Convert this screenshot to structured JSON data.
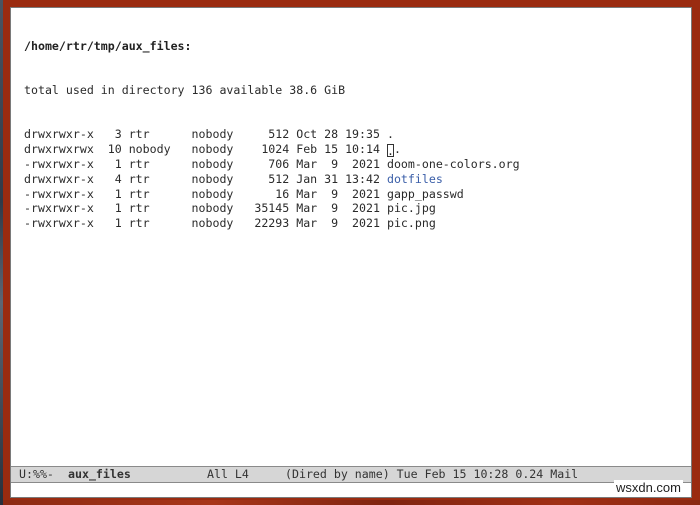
{
  "dired": {
    "path_header": "/home/rtr/tmp/aux_files:",
    "summary": "total used in directory 136 available 38.6 GiB",
    "entries": [
      {
        "perms": "drwxrwxr-x",
        "links": "3",
        "owner": "rtr",
        "group": "nobody",
        "size": "512",
        "date": "Oct 28 19:35",
        "name": "."
      },
      {
        "perms": "drwxrwxrwx",
        "links": "10",
        "owner": "nobody",
        "group": "nobody",
        "size": "1024",
        "date": "Feb 15 10:14",
        "name": ".."
      },
      {
        "perms": "-rwxrwxr-x",
        "links": "1",
        "owner": "rtr",
        "group": "nobody",
        "size": "706",
        "date": "Mar  9  2021",
        "name": "doom-one-colors.org"
      },
      {
        "perms": "drwxrwxr-x",
        "links": "4",
        "owner": "rtr",
        "group": "nobody",
        "size": "512",
        "date": "Jan 31 13:42",
        "name": "dotfiles"
      },
      {
        "perms": "-rwxrwxr-x",
        "links": "1",
        "owner": "rtr",
        "group": "nobody",
        "size": "16",
        "date": "Mar  9  2021",
        "name": "gapp_passwd"
      },
      {
        "perms": "-rwxrwxr-x",
        "links": "1",
        "owner": "rtr",
        "group": "nobody",
        "size": "35145",
        "date": "Mar  9  2021",
        "name": "pic.jpg"
      },
      {
        "perms": "-rwxrwxr-x",
        "links": "1",
        "owner": "rtr",
        "group": "nobody",
        "size": "22293",
        "date": "Mar  9  2021",
        "name": "pic.png"
      }
    ],
    "cursor_line": 1
  },
  "modeline": {
    "status": "U:%%-",
    "buffer_name": "aux_files",
    "position": "All L4",
    "mode_info": "(Dired by name) Tue Feb 15 10:28 0.24 Mail"
  },
  "colors": {
    "frame": "#9a2b10",
    "directory_name": "#3a5ea8",
    "modeline_bg": "#d6d6d6"
  },
  "watermark": "wsxdn.com"
}
